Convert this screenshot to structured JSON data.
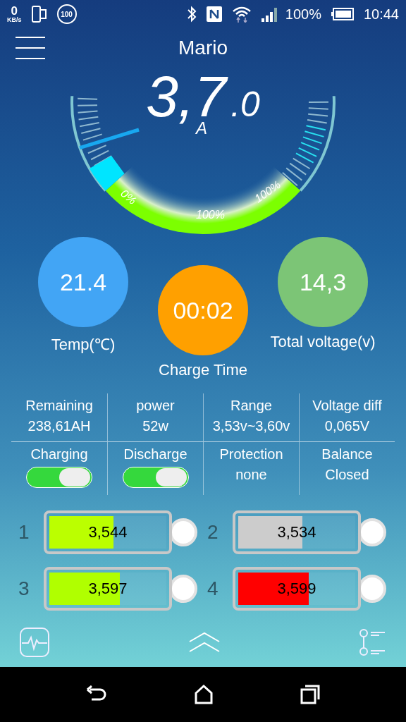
{
  "status_bar": {
    "speed": "0",
    "speed_unit": "KB/s",
    "badge": "100",
    "battery": "100%",
    "time": "10:44"
  },
  "header": {
    "title": "Mario"
  },
  "gauge": {
    "value": "3,7",
    "decimal": ".0",
    "unit": "A",
    "labels": [
      "0%",
      "100%",
      "100%"
    ]
  },
  "circles": [
    {
      "value": "21.4",
      "label": "Temp(℃)",
      "color": "#42a5f5"
    },
    {
      "value": "00:02",
      "label": "Charge Time",
      "color": "#ffa000"
    },
    {
      "value": "14,3",
      "label": "Total voltage(v)",
      "color": "#7cc576"
    }
  ],
  "stats": [
    {
      "label": "Remaining",
      "value": "238,61AH"
    },
    {
      "label": "power",
      "value": "52w"
    },
    {
      "label": "Range",
      "value": "3,53v~3,60v"
    },
    {
      "label": "Voltage diff",
      "value": "0,065V"
    }
  ],
  "modes": [
    {
      "kind": "switch",
      "label": "Charging",
      "on": true
    },
    {
      "kind": "switch",
      "label": "Discharge",
      "on": true
    },
    {
      "kind": "text",
      "label": "Protection",
      "value": "none"
    },
    {
      "kind": "text",
      "label": "Balance",
      "value": "Closed"
    }
  ],
  "cells": [
    {
      "index": "1",
      "reading": "3,544",
      "level": 0.55,
      "color": "#bbff00"
    },
    {
      "index": "2",
      "reading": "3,534",
      "level": 0.55,
      "color": "#cccccc"
    },
    {
      "index": "3",
      "reading": "3,597",
      "level": 0.6,
      "color": "#b0ff00"
    },
    {
      "index": "4",
      "reading": "3,599",
      "level": 0.6,
      "color": "#ff0000"
    }
  ]
}
